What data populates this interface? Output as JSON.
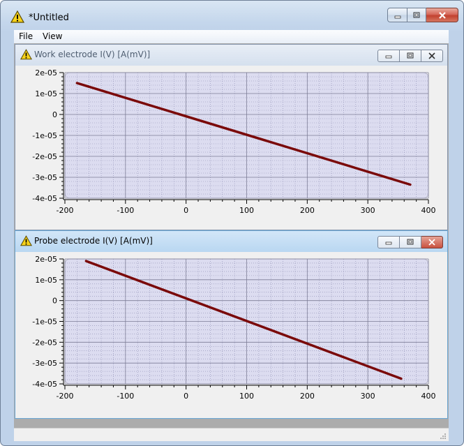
{
  "window": {
    "title": "*Untitled"
  },
  "menu": {
    "items": [
      "File",
      "View"
    ]
  },
  "windows": [
    {
      "title": "Work electrode I(V) [A(mV)]",
      "chart_data": {
        "type": "line",
        "x": [
          -180,
          370
        ],
        "y": [
          1.5e-05,
          -3.35e-05
        ],
        "xlim": [
          -200,
          400
        ],
        "ylim": [
          -4e-05,
          2e-05
        ],
        "xticks": [
          "-200",
          "-100",
          "0",
          "100",
          "200",
          "300",
          "400"
        ],
        "yticks": [
          "2e-05",
          "1e-05",
          "0",
          "-1e-05",
          "-2e-05",
          "-3e-05",
          "-4e-05"
        ],
        "line_color": "#7a0a0a",
        "plot_bg": "#dcdcf0",
        "grid": true
      }
    },
    {
      "title": "Probe electrode I(V) [A(mV)]",
      "chart_data": {
        "type": "line",
        "x": [
          -165,
          355
        ],
        "y": [
          1.9e-05,
          -3.75e-05
        ],
        "xlim": [
          -200,
          400
        ],
        "ylim": [
          -4e-05,
          2e-05
        ],
        "xticks": [
          "-200",
          "-100",
          "0",
          "100",
          "200",
          "300",
          "400"
        ],
        "yticks": [
          "2e-05",
          "1e-05",
          "0",
          "-1e-05",
          "-2e-05",
          "-3e-05",
          "-4e-05"
        ],
        "line_color": "#7a0a0a",
        "plot_bg": "#dcdcf0",
        "grid": true
      }
    }
  ]
}
